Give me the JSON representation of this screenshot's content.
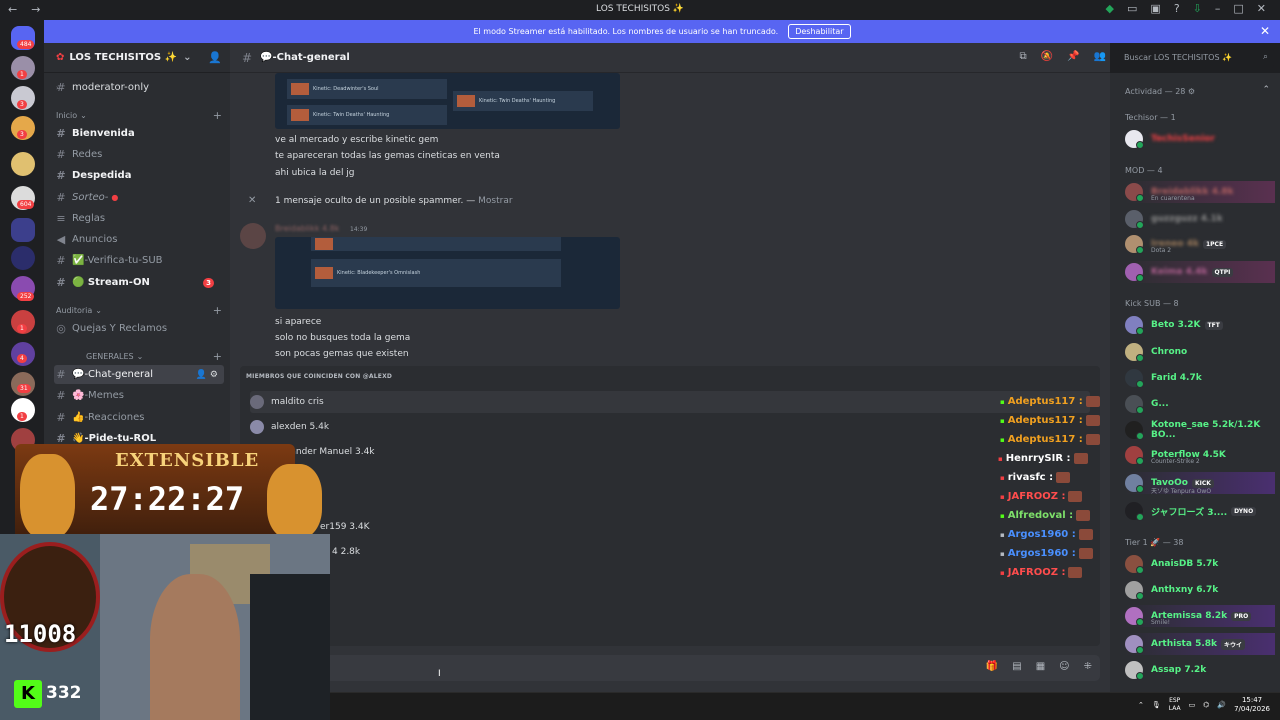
{
  "titlebar": {
    "title": "LOS TECHISITOS ✨",
    "back": "←",
    "forward": "→"
  },
  "banner": {
    "text": "El modo Streamer está habilitado. Los nombres de usuario se han truncado.",
    "button": "Deshabilitar"
  },
  "guild": {
    "name": "LOS TECHISITOS ✨"
  },
  "channels": {
    "top": {
      "label": "moderator-only"
    },
    "cat_inicio": "Inicio",
    "inicio": [
      {
        "label": "Bienvenida",
        "bold": true
      },
      {
        "label": "Redes",
        "bold": false
      },
      {
        "label": "Despedida",
        "bold": true
      },
      {
        "label": "Sorteo-",
        "bold": false
      },
      {
        "label": "Reglas",
        "bold": false
      },
      {
        "label": "Anuncios",
        "bold": false
      },
      {
        "label": "✅-Verifica-tu-SUB",
        "bold": false
      },
      {
        "label": "🟢 Stream-ON",
        "bold": true,
        "badge": "3"
      }
    ],
    "cat_auditoria": "Auditoria",
    "auditoria": [
      {
        "label": "Quejas Y Reclamos"
      }
    ],
    "cat_generales": "GENERALES",
    "generales": [
      {
        "label": "💬-Chat-general",
        "active": true
      },
      {
        "label": "🌸-Memes"
      },
      {
        "label": "👍-Reacciones"
      },
      {
        "label": "👋-Pide-tu-ROL"
      }
    ]
  },
  "header": {
    "channel": "💬-Chat-general",
    "search_placeholder": "Buscar LOS TECHISITOS ✨"
  },
  "chat": {
    "embed_rows": [
      "Kinetic: Deadwinter's Soul",
      "Kinetic: Twin Deaths' Haunting",
      "Kinetic: Twin Deaths' Haunting",
      "Kinetic: Bladekeeper's Omnislash"
    ],
    "messages1": [
      "ve al mercado y escribe kinetic gem",
      "te apareceran todas las gemas cineticas en venta",
      "ahi ubica la del jg"
    ],
    "system": "1 mensaje oculto de un posible spammer. —",
    "system_show": "Mostrar",
    "author": "Breidablikk 4.8k",
    "timestamp": "14:39",
    "messages2": [
      "si aparece",
      "solo no busques toda la gema",
      "son pocas gemas que existen"
    ]
  },
  "popup": {
    "title": "MIEMBROS QUE COINCIDEN CON @ALEXD",
    "members": [
      "maldito cris",
      "alexden 5.4k",
      "Alexander Manuel 3.4k",
      "",
      "",
      "er159 3.4K",
      "4 2.8k"
    ]
  },
  "overlay_chat": [
    {
      "name": "Adeptus117 :",
      "color": "#f0a020"
    },
    {
      "name": "Adeptus117 :",
      "color": "#f0a020"
    },
    {
      "name": "Adeptus117 :",
      "color": "#f0a020"
    },
    {
      "name": "HenrrySIR :",
      "color": "#ffffff"
    },
    {
      "name": "rivasfc :",
      "color": "#ffffff"
    },
    {
      "name": "JAFROOZ :",
      "color": "#ff4d4d"
    },
    {
      "name": "Alfredoval :",
      "color": "#7ee06a"
    },
    {
      "name": "Argos1960 :",
      "color": "#4a90ff"
    },
    {
      "name": "Argos1960 :",
      "color": "#4a90ff"
    },
    {
      "name": "JAFROOZ :",
      "color": "#ff4d4d"
    }
  ],
  "members": {
    "activity": "Actividad — 28",
    "techisor": "Techisor — 1",
    "techisor_list": [
      {
        "name": "TechisSenior",
        "color": "#f23f43"
      }
    ],
    "mod": "MOD — 4",
    "mod_list": [
      {
        "name": "Breidablikk 4.8k",
        "color": "#b06060",
        "sub": "En cuarentena"
      },
      {
        "name": "guzzguzz 4.1k",
        "color": "#8a8a8a"
      },
      {
        "name": "Ireneo 4k",
        "color": "#9b7a5a",
        "sub": "Dota 2",
        "tag": "1PCE"
      },
      {
        "name": "Keima 4.4k",
        "color": "#b06090",
        "tag": "QTPI"
      }
    ],
    "kicksub": "Kick SUB — 8",
    "kicksub_list": [
      {
        "name": "Beto 3.2K",
        "color": "#57f287",
        "tag": "TFT"
      },
      {
        "name": "Chrono",
        "color": "#57f287"
      },
      {
        "name": "Farid 4.7k",
        "color": "#57f287"
      },
      {
        "name": "G...",
        "color": "#57f287"
      },
      {
        "name": "Kotone_sae 5.2k/1.2K BO...",
        "color": "#57f287"
      },
      {
        "name": "Poterflow 4.5K",
        "color": "#57f287",
        "sub": "Counter-Strike 2"
      },
      {
        "name": "TavoOo",
        "color": "#57f287",
        "sub": "天ゾゆ Tenpura OwO",
        "tag": "KICK"
      },
      {
        "name": "ジャフローズ 3....",
        "color": "#57f287",
        "tag": "DYNO"
      }
    ],
    "tier1": "Tier 1 🚀 — 38",
    "tier1_list": [
      {
        "name": "AnaisDB 5.7k",
        "color": "#57f287"
      },
      {
        "name": "Anthxny 6.7k",
        "color": "#57f287"
      },
      {
        "name": "Artemissa 8.2k",
        "color": "#57f287",
        "sub": "Smile!",
        "tag": "PRO"
      },
      {
        "name": "Arthista 5.8k",
        "color": "#57f287",
        "tag": "キウイ"
      },
      {
        "name": "Assap 7.2k",
        "color": "#57f287"
      }
    ]
  },
  "stream": {
    "extensible": "EXTENSIBLE",
    "timer": "27:22:27",
    "roulette": "11008",
    "kick_logo": "K",
    "kick_count": "332"
  },
  "taskbar": {
    "lang1": "ESP",
    "lang2": "LAA",
    "time": "15:47",
    "date": "7/04/2026"
  },
  "server_badges": [
    "484",
    "1",
    "3",
    "3",
    "604",
    "252",
    "1",
    "4",
    "31",
    "1",
    "529"
  ]
}
